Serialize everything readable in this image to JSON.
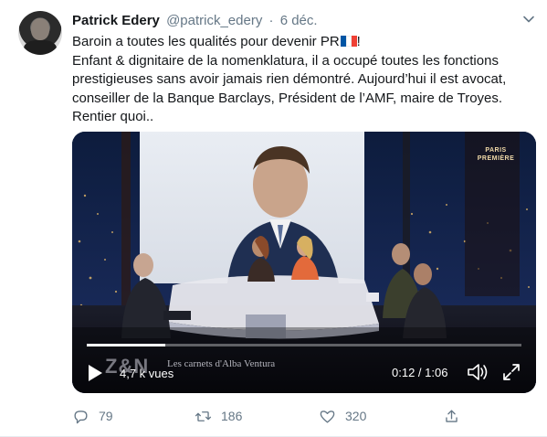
{
  "tweet": {
    "author_name": "Patrick Edery",
    "author_handle": "@patrick_edery",
    "separator": "·",
    "date": "6 déc.",
    "line1": "Baroin a toutes les qualités pour devenir PR",
    "line1_suffix": "!",
    "body": "Enfant & dignitaire de la nomenklatura, il a occupé toutes les fonctions prestigieuses sans avoir jamais rien démontré. Aujourd’hui il est avocat, conseiller de la Banque Barclays, Président de l’AMF, maire de Troyes. Rentier quoi.."
  },
  "video": {
    "views": "4,7 k vues",
    "time": "0:12 / 1:06",
    "progress": 0.18,
    "channel_logo_line1": "PARIS",
    "channel_logo_line2": "PREMIÈRE",
    "overlay_logo": "Z&N",
    "overlay_caption": "Les carnets d'Alba Ventura"
  },
  "actions": {
    "replies": "79",
    "retweets": "186",
    "likes": "320"
  },
  "colors": {
    "text": "#14171a",
    "secondary": "#657786",
    "flag_blue": "#0055a4",
    "flag_red": "#ef4135"
  },
  "icons": [
    "caret-down-icon",
    "reply-icon",
    "retweet-icon",
    "like-icon",
    "share-icon",
    "play-icon",
    "volume-icon",
    "fullscreen-icon",
    "flag-france-icon"
  ]
}
